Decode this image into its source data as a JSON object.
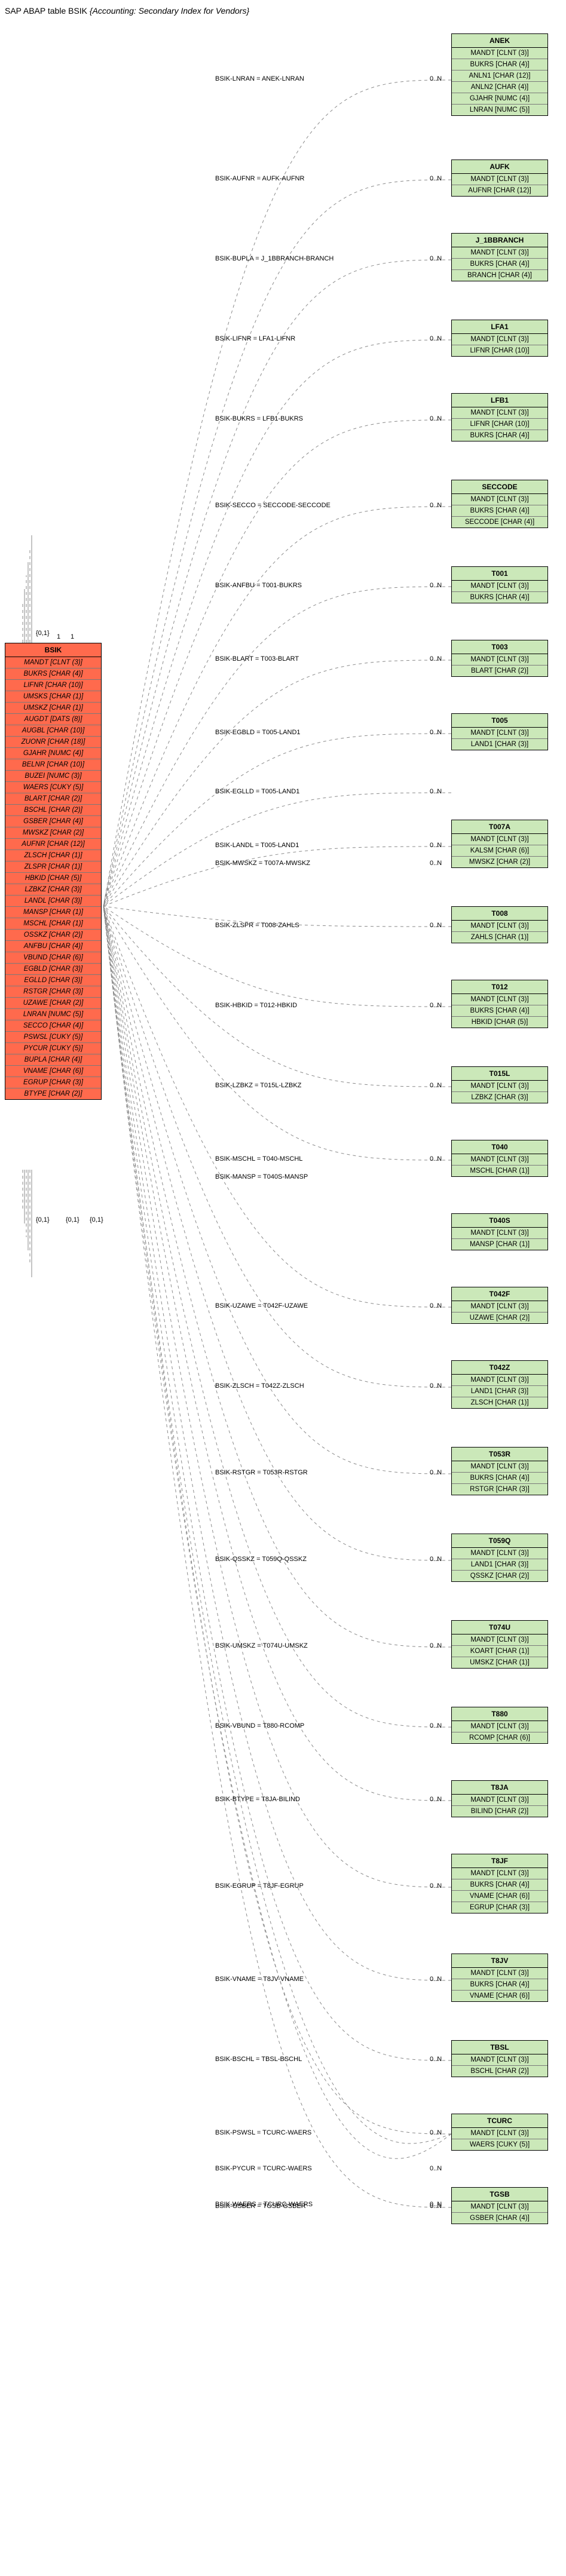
{
  "title_prefix": "SAP ABAP table BSIK ",
  "title_desc": "{Accounting: Secondary Index for Vendors}",
  "main": {
    "name": "BSIK",
    "fields": [
      "MANDT [CLNT (3)]",
      "BUKRS [CHAR (4)]",
      "LIFNR [CHAR (10)]",
      "UMSKS [CHAR (1)]",
      "UMSKZ [CHAR (1)]",
      "AUGDT [DATS (8)]",
      "AUGBL [CHAR (10)]",
      "ZUONR [CHAR (18)]",
      "GJAHR [NUMC (4)]",
      "BELNR [CHAR (10)]",
      "BUZEI [NUMC (3)]",
      "WAERS [CUKY (5)]",
      "BLART [CHAR (2)]",
      "BSCHL [CHAR (2)]",
      "GSBER [CHAR (4)]",
      "MWSKZ [CHAR (2)]",
      "AUFNR [CHAR (12)]",
      "ZLSCH [CHAR (1)]",
      "ZLSPR [CHAR (1)]",
      "HBKID [CHAR (5)]",
      "LZBKZ [CHAR (3)]",
      "LANDL [CHAR (3)]",
      "MANSP [CHAR (1)]",
      "MSCHL [CHAR (1)]",
      "OSSKZ [CHAR (2)]",
      "ANFBU [CHAR (4)]",
      "VBUND [CHAR (6)]",
      "EGBLD [CHAR (3)]",
      "EGLLD [CHAR (3)]",
      "RSTGR [CHAR (3)]",
      "UZAWE [CHAR (2)]",
      "LNRAN [NUMC (5)]",
      "SECCO [CHAR (4)]",
      "PSWSL [CUKY (5)]",
      "PYCUR [CUKY (5)]",
      "BUPLA [CHAR (4)]",
      "VNAME [CHAR (6)]",
      "EGRUP [CHAR (3)]",
      "BTYPE [CHAR (2)]"
    ]
  },
  "targets": [
    {
      "name": "ANEK",
      "fields": [
        "MANDT [CLNT (3)]",
        "BUKRS [CHAR (4)]",
        "ANLN1 [CHAR (12)]",
        "ANLN2 [CHAR (4)]",
        "GJAHR [NUMC (4)]",
        "LNRAN [NUMC (5)]"
      ],
      "edge": "BSIK-LNRAN = ANEK-LNRAN",
      "card": "0..N",
      "lcard": "{0,1}"
    },
    {
      "name": "AUFK",
      "fields": [
        "MANDT [CLNT (3)]",
        "AUFNR [CHAR (12)]"
      ],
      "edge": "BSIK-AUFNR = AUFK-AUFNR",
      "card": "0..N",
      "lcard": "{0,1}"
    },
    {
      "name": "J_1BBRANCH",
      "fields": [
        "MANDT [CLNT (3)]",
        "BUKRS [CHAR (4)]",
        "BRANCH [CHAR (4)]"
      ],
      "edge": "BSIK-BUPLA = J_1BBRANCH-BRANCH",
      "card": "0..N",
      "lcard": "{0,1}"
    },
    {
      "name": "LFA1",
      "fields": [
        "MANDT [CLNT (3)]",
        "LIFNR [CHAR (10)]"
      ],
      "edge": "BSIK-LIFNR = LFA1-LIFNR",
      "card": "0..N",
      "lcard": "1"
    },
    {
      "name": "LFB1",
      "fields": [
        "MANDT [CLNT (3)]",
        "LIFNR [CHAR (10)]",
        "BUKRS [CHAR (4)]"
      ],
      "edge": "BSIK-BUKRS = LFB1-BUKRS",
      "card": "0..N",
      "lcard": "1"
    },
    {
      "name": "SECCODE",
      "fields": [
        "MANDT [CLNT (3)]",
        "BUKRS [CHAR (4)]",
        "SECCODE [CHAR (4)]"
      ],
      "edge": "BSIK-SECCO = SECCODE-SECCODE",
      "card": "0..N",
      "lcard": "{0,1}"
    },
    {
      "name": "T001",
      "fields": [
        "MANDT [CLNT (3)]",
        "BUKRS [CHAR (4)]"
      ],
      "edge": "BSIK-ANFBU = T001-BUKRS",
      "card": "0..N",
      "lcard": "{0,1}"
    },
    {
      "name": "T003",
      "fields": [
        "MANDT [CLNT (3)]",
        "BLART [CHAR (2)]"
      ],
      "edge": "BSIK-BLART = T003-BLART",
      "card": "0..N",
      "lcard": "{0,1}"
    },
    {
      "name": "T005",
      "fields": [
        "MANDT [CLNT (3)]",
        "LAND1 [CHAR (3)]"
      ],
      "edge": "BSIK-EGBLD = T005-LAND1",
      "card": "0..N",
      "lcard": "{0,1}"
    },
    {
      "name": "",
      "fields": [],
      "edge": "BSIK-EGLLD = T005-LAND1",
      "card": "0..N",
      "lcard": "{0,1}",
      "skip": true
    },
    {
      "name": "T007A",
      "fields": [
        "MANDT [CLNT (3)]",
        "KALSM [CHAR (6)]",
        "MWSKZ [CHAR (2)]"
      ],
      "edge": "BSIK-LANDL = T005-LAND1",
      "card": "0..N",
      "lcard": "{0,1}",
      "extraEdge": "BSIK-MWSKZ = T007A-MWSKZ",
      "extraCard": "0..N"
    },
    {
      "name": "T008",
      "fields": [
        "MANDT [CLNT (3)]",
        "ZAHLS [CHAR (1)]"
      ],
      "edge": "BSIK-ZLSPR = T008-ZAHLS",
      "card": "0..N",
      "lcard": "{0,1}"
    },
    {
      "name": "T012",
      "fields": [
        "MANDT [CLNT (3)]",
        "BUKRS [CHAR (4)]",
        "HBKID [CHAR (5)]"
      ],
      "edge": "BSIK-HBKID = T012-HBKID",
      "card": "0..N",
      "lcard": "{0,1}"
    },
    {
      "name": "T015L",
      "fields": [
        "MANDT [CLNT (3)]",
        "LZBKZ [CHAR (3)]"
      ],
      "edge": "BSIK-LZBKZ = T015L-LZBKZ",
      "card": "0..N",
      "lcard": "{0,1}"
    },
    {
      "name": "T040",
      "fields": [
        "MANDT [CLNT (3)]",
        "MSCHL [CHAR (1)]"
      ],
      "edge": "BSIK-MSCHL = T040-MSCHL",
      "card": "0..N",
      "lcard": "{0,1}",
      "extraEdge": "BSIK-MANSP = T040S-MANSP",
      "extraLcard": "{0,1}"
    },
    {
      "name": "T040S",
      "fields": [
        "MANDT [CLNT (3)]",
        "MANSP [CHAR (1)]"
      ],
      "edge": "",
      "card": "0..N",
      "lcard": "{0,1}",
      "stack": true
    },
    {
      "name": "T042F",
      "fields": [
        "MANDT [CLNT (3)]",
        "UZAWE [CHAR (2)]"
      ],
      "edge": "BSIK-UZAWE = T042F-UZAWE",
      "card": "0..N",
      "lcard": "{0,1}"
    },
    {
      "name": "T042Z",
      "fields": [
        "MANDT [CLNT (3)]",
        "LAND1 [CHAR (3)]",
        "ZLSCH [CHAR (1)]"
      ],
      "edge": "BSIK-ZLSCH = T042Z-ZLSCH",
      "card": "0..N",
      "lcard": "{0,1}"
    },
    {
      "name": "T053R",
      "fields": [
        "MANDT [CLNT (3)]",
        "BUKRS [CHAR (4)]",
        "RSTGR [CHAR (3)]"
      ],
      "edge": "BSIK-RSTGR = T053R-RSTGR",
      "card": "0..N",
      "lcard": "{0,1}"
    },
    {
      "name": "T059Q",
      "fields": [
        "MANDT [CLNT (3)]",
        "LAND1 [CHAR (3)]",
        "QSSKZ [CHAR (2)]"
      ],
      "edge": "BSIK-QSSKZ = T059Q-QSSKZ",
      "card": "0..N",
      "lcard": "{0,1}"
    },
    {
      "name": "T074U",
      "fields": [
        "MANDT [CLNT (3)]",
        "KOART [CHAR (1)]",
        "UMSKZ [CHAR (1)]"
      ],
      "edge": "BSIK-UMSKZ = T074U-UMSKZ",
      "card": "0..N",
      "lcard": "{0,1}"
    },
    {
      "name": "T880",
      "fields": [
        "MANDT [CLNT (3)]",
        "RCOMP [CHAR (6)]"
      ],
      "edge": "BSIK-VBUND = T880-RCOMP",
      "card": "0..N",
      "lcard": "{0,1}"
    },
    {
      "name": "T8JA",
      "fields": [
        "MANDT [CLNT (3)]",
        "BILIND [CHAR (2)]"
      ],
      "edge": "BSIK-BTYPE = T8JA-BILIND",
      "card": "0..N",
      "lcard": "{0,1}"
    },
    {
      "name": "T8JF",
      "fields": [
        "MANDT [CLNT (3)]",
        "BUKRS [CHAR (4)]",
        "VNAME [CHAR (6)]",
        "EGRUP [CHAR (3)]"
      ],
      "edge": "BSIK-EGRUP = T8JF-EGRUP",
      "card": "0..N",
      "lcard": "{0,1}"
    },
    {
      "name": "T8JV",
      "fields": [
        "MANDT [CLNT (3)]",
        "BUKRS [CHAR (4)]",
        "VNAME [CHAR (6)]"
      ],
      "edge": "BSIK-VNAME = T8JV-VNAME",
      "card": "0..N",
      "lcard": "{0,1}"
    },
    {
      "name": "TBSL",
      "fields": [
        "MANDT [CLNT (3)]",
        "BSCHL [CHAR (2)]"
      ],
      "edge": "BSIK-BSCHL = TBSL-BSCHL",
      "card": "0..N",
      "lcard": "{0,1}"
    },
    {
      "name": "TCURC",
      "fields": [
        "MANDT [CLNT (3)]",
        "WAERS [CUKY (5)]"
      ],
      "edge": "BSIK-PSWSL = TCURC-WAERS",
      "card": "0..N",
      "lcard": "{0,1}",
      "extraEdges": [
        {
          "edge": "BSIK-PYCUR = TCURC-WAERS",
          "card": "0..N",
          "lcard": "{0,1}"
        },
        {
          "edge": "BSIK-WAERS = TCURC-WAERS",
          "card": "0..N",
          "lcard": "1"
        }
      ]
    },
    {
      "name": "TGSB",
      "fields": [
        "MANDT [CLNT (3)]",
        "GSBER [CHAR (4)]"
      ],
      "edge": "BSIK-GSBER = TGSB-GSBER",
      "card": "0..N",
      "lcard": "{0,1}"
    }
  ]
}
